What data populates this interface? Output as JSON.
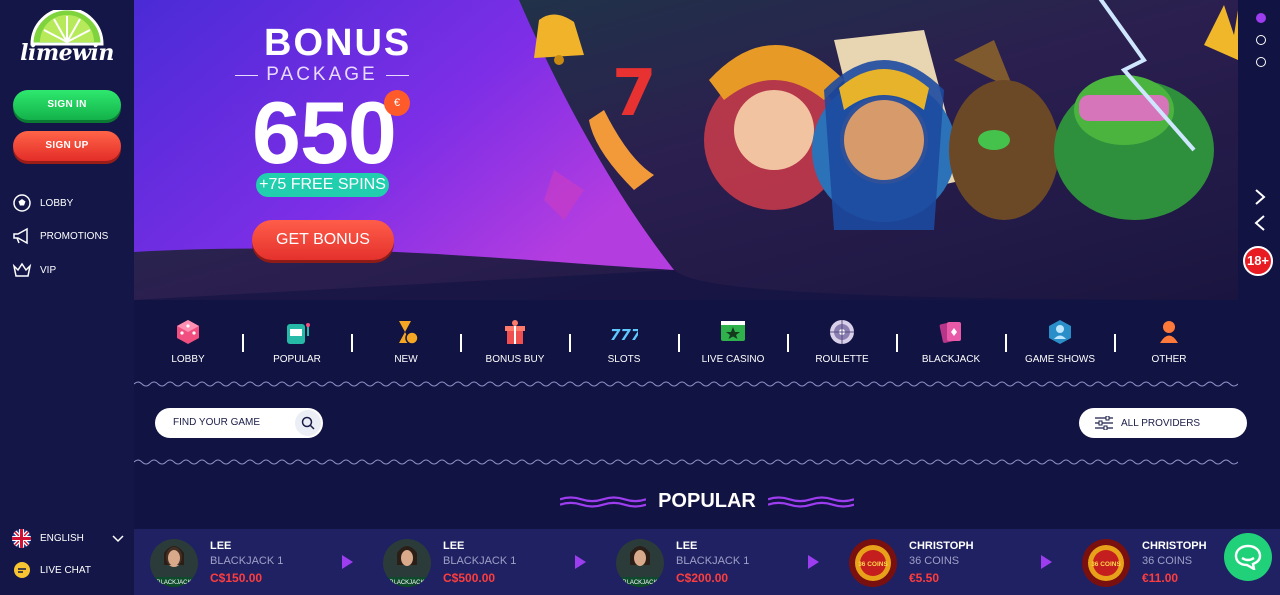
{
  "sidebar": {
    "logo_text": "limewin",
    "sign_in": "SIGN IN",
    "sign_up": "SIGN UP",
    "items": [
      {
        "label": "LOBBY",
        "icon": "soccer-ball-icon"
      },
      {
        "label": "PROMOTIONS",
        "icon": "megaphone-icon"
      },
      {
        "label": "VIP",
        "icon": "crown-icon"
      }
    ],
    "language": "ENGLISH",
    "live_chat": "LIVE CHAT"
  },
  "banner": {
    "title": "BONUS",
    "subtitle": "PACKAGE",
    "amount": "650",
    "currency": "€",
    "spins": "+75 FREE SPINS",
    "cta": "GET BONUS",
    "age_badge": "18+"
  },
  "categories": [
    {
      "label": "LOBBY",
      "icon": "dice-icon"
    },
    {
      "label": "POPULAR",
      "icon": "slot-machine-icon"
    },
    {
      "label": "NEW",
      "icon": "hourglass-icon"
    },
    {
      "label": "BONUS BUY",
      "icon": "gift-icon"
    },
    {
      "label": "SLOTS",
      "icon": "777-icon"
    },
    {
      "label": "LIVE CASINO",
      "icon": "tv-star-icon"
    },
    {
      "label": "ROULETTE",
      "icon": "roulette-icon"
    },
    {
      "label": "BLACKJACK",
      "icon": "cards-icon"
    },
    {
      "label": "GAME SHOWS",
      "icon": "host-icon"
    },
    {
      "label": "OTHER",
      "icon": "other-icon"
    }
  ],
  "search": {
    "placeholder": "FIND YOUR GAME"
  },
  "providers": {
    "label": "ALL PROVIDERS"
  },
  "popular": {
    "heading": "POPULAR"
  },
  "wins": [
    {
      "name": "LEE",
      "game": "BLACKJACK 1",
      "amount": "C$150.00"
    },
    {
      "name": "LEE",
      "game": "BLACKJACK 1",
      "amount": "C$500.00"
    },
    {
      "name": "LEE",
      "game": "BLACKJACK 1",
      "amount": "C$200.00"
    },
    {
      "name": "CHRISTOPH",
      "game": "36 COINS",
      "amount": "€5.50"
    },
    {
      "name": "CHRISTOPH",
      "game": "36 COINS",
      "amount": "€11.00"
    }
  ],
  "thumb_labels": {
    "blackjack": "BLACKJACK",
    "coins": "36 COINS"
  },
  "colors": {
    "accent": "#9d3df0",
    "green": "#21d17a",
    "red": "#e4312c",
    "teal": "#21cfae",
    "bg": "#111342"
  }
}
